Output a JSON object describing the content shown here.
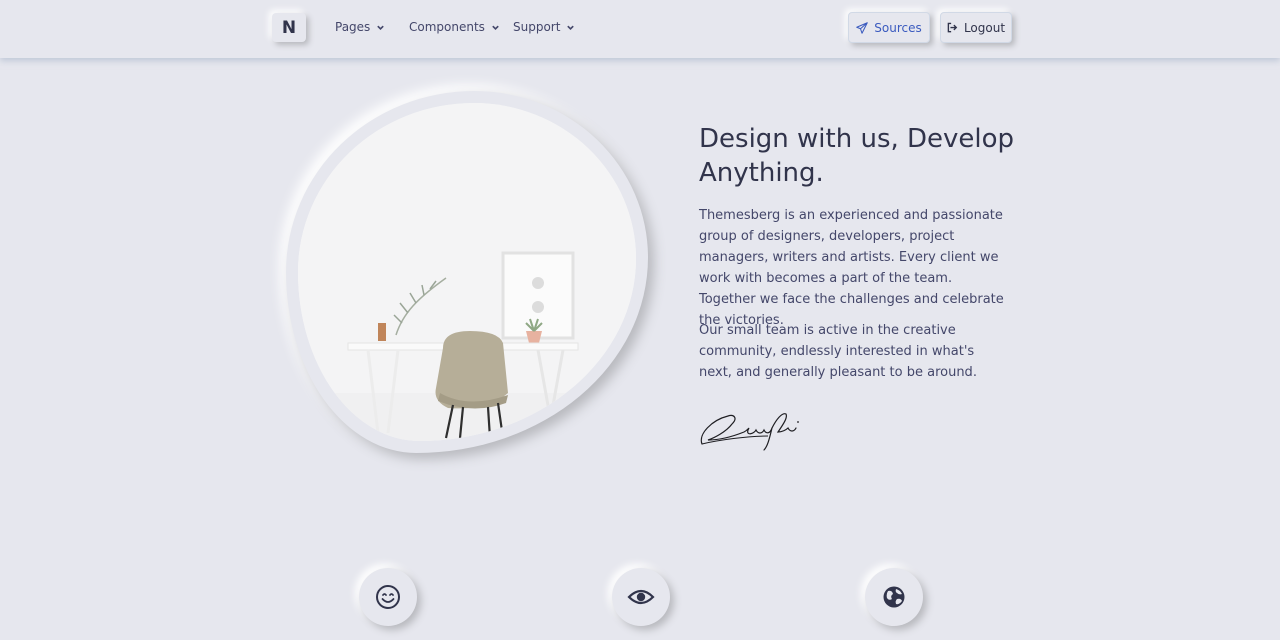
{
  "navbar": {
    "brand": "N",
    "menu": [
      {
        "label": "Pages"
      },
      {
        "label": "Components"
      },
      {
        "label": "Support"
      }
    ],
    "sources_label": "Sources",
    "logout_label": "Logout"
  },
  "hero": {
    "title": "Design with us, Develop Anything.",
    "paragraph1": "Themesberg is an experienced and passionate group of designers, developers, project managers, writers and artists. Every client we work with becomes a part of the team. Together we face the challenges and celebrate the victories.",
    "paragraph2": "Our small team is active in the creative community, endlessly interested in what's next, and generally pleasant to be around.",
    "image_icon": "desk-chair-photo",
    "signature_icon": "signature-icon"
  },
  "features": {
    "icons": [
      "smile-icon",
      "eye-icon",
      "globe-icon"
    ]
  },
  "colors": {
    "background": "#e6e7ee",
    "text": "#44476a",
    "heading": "#31344b",
    "accent": "#3b5bbf"
  }
}
